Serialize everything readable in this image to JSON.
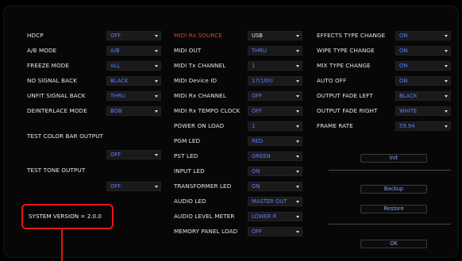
{
  "col1": {
    "rows": [
      {
        "label": "HDCP",
        "value": "OFF"
      },
      {
        "label": "A/B MODE",
        "value": "A/B"
      },
      {
        "label": "FREEZE MODE",
        "value": "ALL"
      },
      {
        "label": "NO SIGNAL BACK",
        "value": "BLACK"
      },
      {
        "label": "UNFIT SIGNAL BACK",
        "value": "THRU"
      },
      {
        "label": "DEINTERLACE MODE",
        "value": "BOB"
      }
    ],
    "test_color_bar": {
      "label": "TEST COLOR BAR OUTPUT",
      "value": "OFF"
    },
    "test_tone": {
      "label": "TEST TONE OUTPUT",
      "value": "OFF"
    },
    "system_version": "SYSTEM VERSION = 2.0.0"
  },
  "col2": {
    "rows": [
      {
        "label": "MIDI Rx SOURCE",
        "value": "USB"
      },
      {
        "label": "MIDI OUT",
        "value": "THRU"
      },
      {
        "label": "MIDI Tx CHANNEL",
        "value": "1"
      },
      {
        "label": "MIDI Device ID",
        "value": "17(10h)"
      },
      {
        "label": "MIDI Rx CHANNEL",
        "value": "OFF"
      },
      {
        "label": "MIDI Rx TEMPO CLOCK",
        "value": "OFF"
      },
      {
        "label": "POWER ON LOAD",
        "value": "1"
      },
      {
        "label": "PGM LED",
        "value": "RED"
      },
      {
        "label": "PST LED",
        "value": "GREEN"
      },
      {
        "label": "INPUT LED",
        "value": "ON"
      },
      {
        "label": "TRANSFORMER LED",
        "value": "ON"
      },
      {
        "label": "AUDIO LED",
        "value": "MASTER OUT"
      },
      {
        "label": "AUDIO LEVEL METER",
        "value": "LOWER R"
      },
      {
        "label": "MEMORY PANEL LOAD",
        "value": "OFF"
      }
    ]
  },
  "col3": {
    "rows": [
      {
        "label": "EFFECTS TYPE CHANGE",
        "value": "ON"
      },
      {
        "label": "WIPE TYPE CHANGE",
        "value": "ON"
      },
      {
        "label": "MIX TYPE CHANGE",
        "value": "ON"
      },
      {
        "label": "AUTO OFF",
        "value": "ON"
      },
      {
        "label": "OUTPUT FADE LEFT",
        "value": "BLACK"
      },
      {
        "label": "OUTPUT FADE RIGHT",
        "value": "WHITE"
      },
      {
        "label": "FRAME RATE",
        "value": "59.94"
      }
    ],
    "buttons": {
      "init": "Init",
      "backup": "Backup",
      "restore": "Restore",
      "ok": "OK"
    }
  },
  "colors": {
    "highlight": "#e11111",
    "value_blue": "#5d7cff"
  },
  "icons": {
    "dropdown": "chevron-down-icon"
  }
}
